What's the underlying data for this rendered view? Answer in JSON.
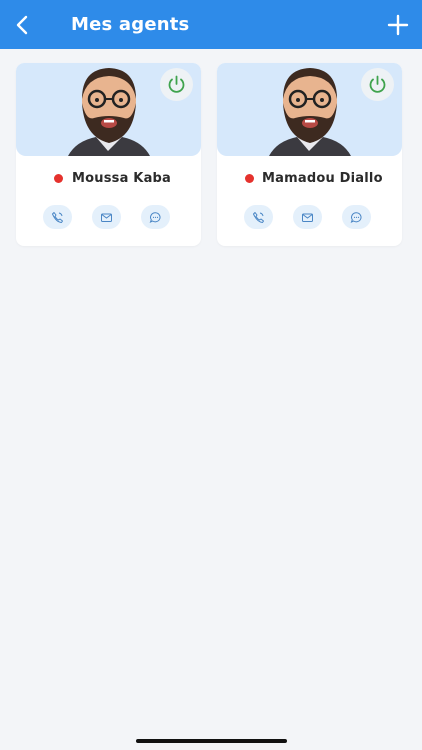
{
  "header": {
    "title": "Mes agents",
    "back_icon": "chevron-left-icon",
    "add_icon": "plus-icon",
    "background": "#2e8be9"
  },
  "agents": [
    {
      "name": "Moussa Kaba",
      "status_color": "#e5322d",
      "power_color": "#3fa34d"
    },
    {
      "name": "Mamadou Diallo",
      "status_color": "#e5322d",
      "power_color": "#3fa34d"
    }
  ],
  "actions": [
    "phone-icon",
    "mail-icon",
    "chat-icon"
  ]
}
